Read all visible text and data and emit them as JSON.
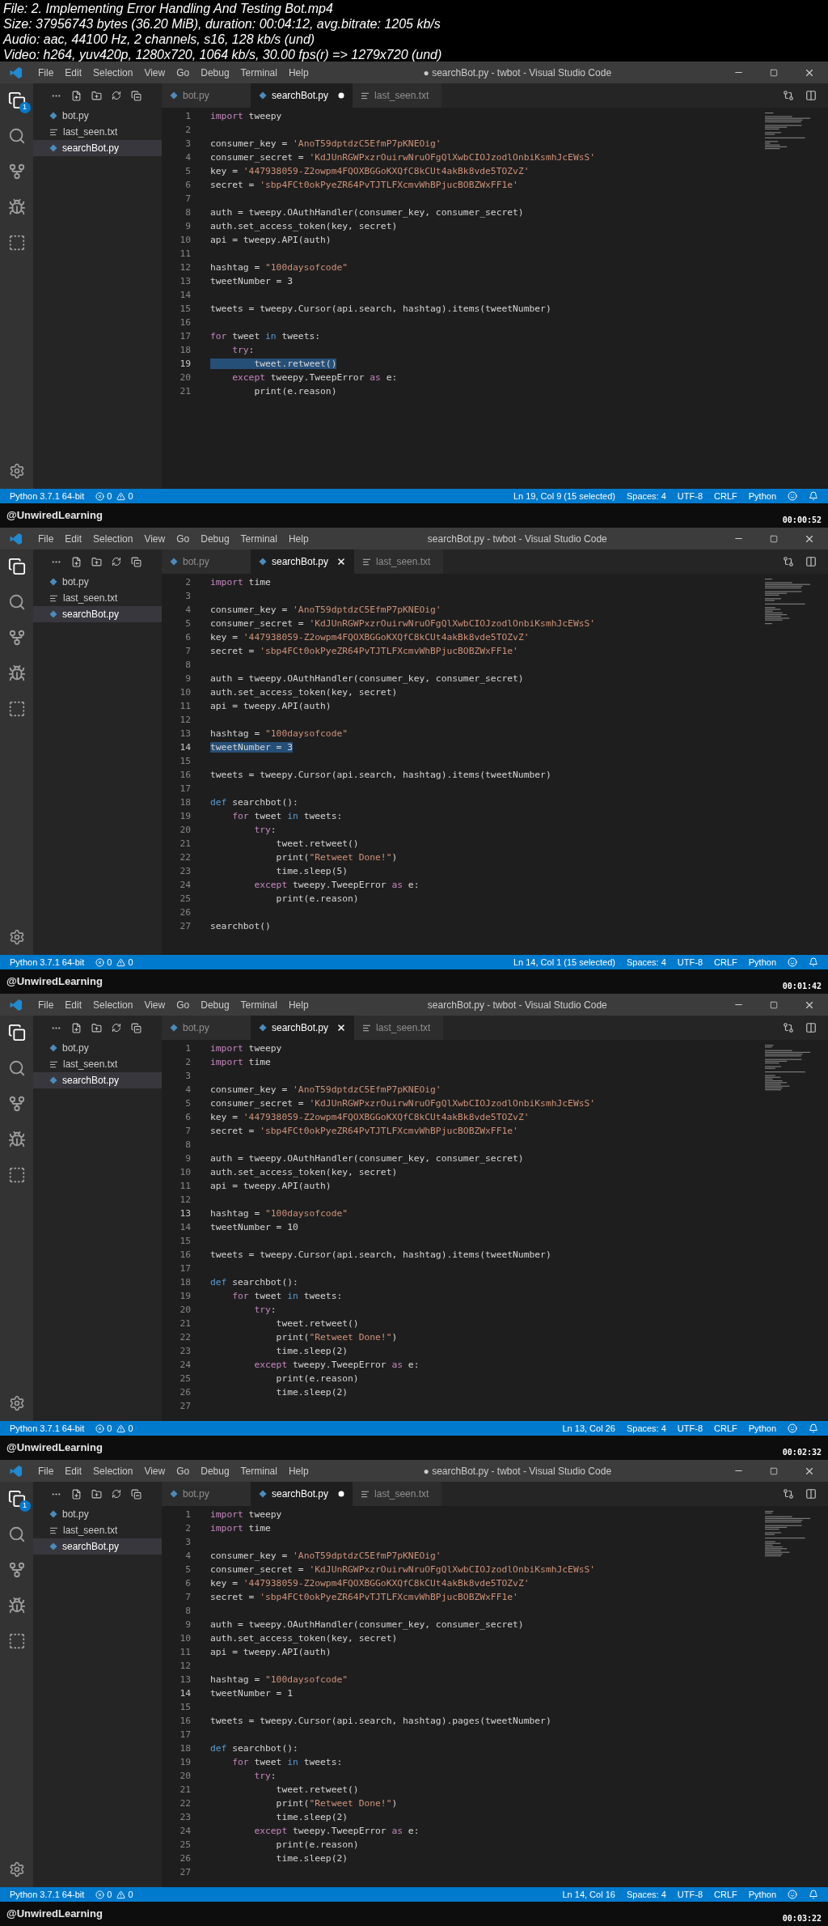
{
  "file_info": [
    "File: 2. Implementing Error Handling And Testing Bot.mp4",
    "Size: 37956743 bytes (36.20 MiB), duration: 00:04:12, avg.bitrate: 1205 kb/s",
    "Audio: aac, 44100 Hz, 2 channels, s16, 128 kb/s (und)",
    "Video: h264, yuv420p, 1280x720, 1064 kb/s, 30.00 fps(r) => 1279x720 (und)"
  ],
  "frames": [
    {
      "title": "● searchBot.py - twbot - Visual Studio Code",
      "menu": [
        "File",
        "Edit",
        "Selection",
        "View",
        "Go",
        "Debug",
        "Terminal",
        "Help"
      ],
      "explorer_badge": "1",
      "files": [
        {
          "name": "bot.py",
          "kind": "py",
          "selected": false
        },
        {
          "name": "last_seen.txt",
          "kind": "txt",
          "selected": false
        },
        {
          "name": "searchBot.py",
          "kind": "py",
          "selected": true
        }
      ],
      "tabs": [
        {
          "label": "bot.py",
          "kind": "py",
          "selected": false
        },
        {
          "label": "searchBot.py",
          "kind": "py",
          "selected": true,
          "dirty": true
        },
        {
          "label": "last_seen.txt",
          "kind": "txt",
          "selected": false
        }
      ],
      "lines": [
        {
          "n": "1",
          "current": false,
          "tokens": [
            {
              "text": "import",
              "kind": "kw"
            },
            {
              "text": " tweepy",
              "kind": "plain"
            }
          ]
        },
        {
          "n": "2",
          "current": false
        },
        {
          "n": "3",
          "current": false,
          "tokens": [
            {
              "text": "consumer_key = ",
              "kind": "plain"
            },
            {
              "text": "'AnoT59dptdzC5EfmP7pKNEOig'",
              "kind": "str"
            }
          ]
        },
        {
          "n": "4",
          "current": false,
          "tokens": [
            {
              "text": "consumer_secret = ",
              "kind": "plain"
            },
            {
              "text": "'KdJUnRGWPxzrOuirwNruOFgQlXwbCIOJzodlOnbiKsmhJcEWsS'",
              "kind": "str"
            }
          ]
        },
        {
          "n": "5",
          "current": false,
          "tokens": [
            {
              "text": "key = ",
              "kind": "plain"
            },
            {
              "text": "'447938059-Z2owpm4FQOXBGGoKXQfC8kCUt4akBk8vde5TOZvZ'",
              "kind": "str"
            }
          ]
        },
        {
          "n": "6",
          "current": false,
          "tokens": [
            {
              "text": "secret = ",
              "kind": "plain"
            },
            {
              "text": "'sbp4FCt0okPyeZR64PvTJTLFXcmvWhBPjucBOBZWxFF1e'",
              "kind": "str"
            }
          ]
        },
        {
          "n": "7",
          "current": false
        },
        {
          "n": "8",
          "current": false,
          "tokens": [
            {
              "text": "auth = tweepy.OAuthHandler(consumer_key, consumer_secret)",
              "kind": "plain"
            }
          ]
        },
        {
          "n": "9",
          "current": false,
          "tokens": [
            {
              "text": "auth.set_access_token(key, secret)",
              "kind": "plain"
            }
          ]
        },
        {
          "n": "10",
          "current": false,
          "tokens": [
            {
              "text": "api = tweepy.API(auth)",
              "kind": "plain"
            }
          ]
        },
        {
          "n": "11",
          "current": false
        },
        {
          "n": "12",
          "current": false,
          "tokens": [
            {
              "text": "hashtag = ",
              "kind": "plain"
            },
            {
              "text": "\"100daysofcode\"",
              "kind": "str"
            }
          ]
        },
        {
          "n": "13",
          "current": false,
          "tokens": [
            {
              "text": "tweetNumber = 3",
              "kind": "plain"
            }
          ]
        },
        {
          "n": "14",
          "current": false
        },
        {
          "n": "15",
          "current": false,
          "tokens": [
            {
              "text": "tweets = tweepy.Cursor(api.search, hashtag).items(tweetNumber)",
              "kind": "plain"
            }
          ]
        },
        {
          "n": "16",
          "current": false
        },
        {
          "n": "17",
          "current": false,
          "tokens": [
            {
              "text": "for",
              "kind": "kw"
            },
            {
              "text": " tweet ",
              "kind": "plain"
            },
            {
              "text": "in",
              "kind": "blue"
            },
            {
              "text": " tweets:",
              "kind": "plain"
            }
          ]
        },
        {
          "n": "18",
          "current": false,
          "tokens": [
            {
              "text": "    try",
              "kind": "kw"
            },
            {
              "text": ":",
              "kind": "plain"
            }
          ]
        },
        {
          "n": "19",
          "current": true,
          "tokens": [
            {
              "text": "        tweet.retweet()",
              "kind": "sel"
            }
          ]
        },
        {
          "n": "20",
          "current": false,
          "tokens": [
            {
              "text": "    except",
              "kind": "kw"
            },
            {
              "text": " tweepy.TweepError ",
              "kind": "plain"
            },
            {
              "text": "as",
              "kind": "kw"
            },
            {
              "text": " e:",
              "kind": "plain"
            }
          ]
        },
        {
          "n": "21",
          "current": false,
          "tokens": [
            {
              "text": "        print(e.reason)",
              "kind": "plain"
            }
          ]
        }
      ],
      "status_left": {
        "interpreter": "Python 3.7.1 64-bit",
        "errors": "0",
        "warnings": "0"
      },
      "status_right": [
        "Ln 19, Col 9 (15 selected)",
        "Spaces: 4",
        "UTF-8",
        "CRLF",
        "Python"
      ],
      "channel": "@UnwiredLearning",
      "timestamp": "00:00:52"
    },
    {
      "title": "searchBot.py - twbot - Visual Studio Code",
      "menu": [
        "File",
        "Edit",
        "Selection",
        "View",
        "Go",
        "Debug",
        "Terminal",
        "Help"
      ],
      "files": [
        {
          "name": "bot.py",
          "kind": "py",
          "selected": false
        },
        {
          "name": "last_seen.txt",
          "kind": "txt",
          "selected": false
        },
        {
          "name": "searchBot.py",
          "kind": "py",
          "selected": true
        }
      ],
      "tabs": [
        {
          "label": "bot.py",
          "kind": "py",
          "selected": false
        },
        {
          "label": "searchBot.py",
          "kind": "py",
          "selected": true,
          "dirty": false
        },
        {
          "label": "last_seen.txt",
          "kind": "txt",
          "selected": false
        }
      ],
      "lines": [
        {
          "n": "2",
          "current": false,
          "tokens": [
            {
              "text": "import",
              "kind": "kw"
            },
            {
              "text": " time",
              "kind": "plain"
            }
          ]
        },
        {
          "n": "3",
          "current": false
        },
        {
          "n": "4",
          "current": false,
          "tokens": [
            {
              "text": "consumer_key = ",
              "kind": "plain"
            },
            {
              "text": "'AnoT59dptdzC5EfmP7pKNEOig'",
              "kind": "str"
            }
          ]
        },
        {
          "n": "5",
          "current": false,
          "tokens": [
            {
              "text": "consumer_secret = ",
              "kind": "plain"
            },
            {
              "text": "'KdJUnRGWPxzrOuirwNruOFgQlXwbCIOJzodlOnbiKsmhJcEWsS'",
              "kind": "str"
            }
          ]
        },
        {
          "n": "6",
          "current": false,
          "tokens": [
            {
              "text": "key = ",
              "kind": "plain"
            },
            {
              "text": "'447938059-Z2owpm4FQOXBGGoKXQfC8kCUt4akBk8vde5TOZvZ'",
              "kind": "str"
            }
          ]
        },
        {
          "n": "7",
          "current": false,
          "tokens": [
            {
              "text": "secret = ",
              "kind": "plain"
            },
            {
              "text": "'sbp4FCt0okPyeZR64PvTJTLFXcmvWhBPjucBOBZWxFF1e'",
              "kind": "str"
            }
          ]
        },
        {
          "n": "8",
          "current": false
        },
        {
          "n": "9",
          "current": false,
          "tokens": [
            {
              "text": "auth = tweepy.OAuthHandler(consumer_key, consumer_secret)",
              "kind": "plain"
            }
          ]
        },
        {
          "n": "10",
          "current": false,
          "tokens": [
            {
              "text": "auth.set_access_token(key, secret)",
              "kind": "plain"
            }
          ]
        },
        {
          "n": "11",
          "current": false,
          "tokens": [
            {
              "text": "api = tweepy.API(auth)",
              "kind": "plain"
            }
          ]
        },
        {
          "n": "12",
          "current": false
        },
        {
          "n": "13",
          "current": false,
          "tokens": [
            {
              "text": "hashtag = ",
              "kind": "plain"
            },
            {
              "text": "\"100daysofcode\"",
              "kind": "str"
            }
          ]
        },
        {
          "n": "14",
          "current": true,
          "tokens": [
            {
              "text": "tweetNumber = 3",
              "kind": "sel"
            }
          ]
        },
        {
          "n": "15",
          "current": false
        },
        {
          "n": "16",
          "current": false,
          "tokens": [
            {
              "text": "tweets = tweepy.Cursor(api.search, hashtag).items(tweetNumber)",
              "kind": "plain"
            }
          ]
        },
        {
          "n": "17",
          "current": false
        },
        {
          "n": "18",
          "current": false,
          "tokens": [
            {
              "text": "def",
              "kind": "blue"
            },
            {
              "text": " searchbot():",
              "kind": "plain"
            }
          ]
        },
        {
          "n": "19",
          "current": false,
          "tokens": [
            {
              "text": "    for",
              "kind": "kw"
            },
            {
              "text": " tweet ",
              "kind": "plain"
            },
            {
              "text": "in",
              "kind": "blue"
            },
            {
              "text": " tweets:",
              "kind": "plain"
            }
          ]
        },
        {
          "n": "20",
          "current": false,
          "tokens": [
            {
              "text": "        try",
              "kind": "kw"
            },
            {
              "text": ":",
              "kind": "plain"
            }
          ]
        },
        {
          "n": "21",
          "current": false,
          "tokens": [
            {
              "text": "            tweet.retweet()",
              "kind": "plain"
            }
          ]
        },
        {
          "n": "22",
          "current": false,
          "tokens": [
            {
              "text": "            print(",
              "kind": "plain"
            },
            {
              "text": "\"Retweet Done!\"",
              "kind": "str"
            },
            {
              "text": ")",
              "kind": "plain"
            }
          ]
        },
        {
          "n": "23",
          "current": false,
          "tokens": [
            {
              "text": "            time.sleep(5)",
              "kind": "plain"
            }
          ]
        },
        {
          "n": "24",
          "current": false,
          "tokens": [
            {
              "text": "        except",
              "kind": "kw"
            },
            {
              "text": " tweepy.TweepError ",
              "kind": "plain"
            },
            {
              "text": "as",
              "kind": "kw"
            },
            {
              "text": " e:",
              "kind": "plain"
            }
          ]
        },
        {
          "n": "25",
          "current": false,
          "tokens": [
            {
              "text": "            print(e.reason)",
              "kind": "plain"
            }
          ]
        },
        {
          "n": "26",
          "current": false
        },
        {
          "n": "27",
          "current": false,
          "tokens": [
            {
              "text": "searchbot()",
              "kind": "plain"
            }
          ]
        }
      ],
      "status_left": {
        "interpreter": "Python 3.7.1 64-bit",
        "errors": "0",
        "warnings": "0"
      },
      "status_right": [
        "Ln 14, Col 1 (15 selected)",
        "Spaces: 4",
        "UTF-8",
        "CRLF",
        "Python"
      ],
      "channel": "@UnwiredLearning",
      "timestamp": "00:01:42"
    },
    {
      "title": "searchBot.py - twbot - Visual Studio Code",
      "menu": [
        "File",
        "Edit",
        "Selection",
        "View",
        "Go",
        "Debug",
        "Terminal",
        "Help"
      ],
      "files": [
        {
          "name": "bot.py",
          "kind": "py",
          "selected": false
        },
        {
          "name": "last_seen.txt",
          "kind": "txt",
          "selected": false
        },
        {
          "name": "searchBot.py",
          "kind": "py",
          "selected": true
        }
      ],
      "tabs": [
        {
          "label": "bot.py",
          "kind": "py",
          "selected": false
        },
        {
          "label": "searchBot.py",
          "kind": "py",
          "selected": true,
          "dirty": false
        },
        {
          "label": "last_seen.txt",
          "kind": "txt",
          "selected": false
        }
      ],
      "lines": [
        {
          "n": "1",
          "current": false,
          "tokens": [
            {
              "text": "import",
              "kind": "kw"
            },
            {
              "text": " tweepy",
              "kind": "plain"
            }
          ]
        },
        {
          "n": "2",
          "current": false,
          "tokens": [
            {
              "text": "import",
              "kind": "kw"
            },
            {
              "text": " time",
              "kind": "plain"
            }
          ]
        },
        {
          "n": "3",
          "current": false
        },
        {
          "n": "4",
          "current": false,
          "tokens": [
            {
              "text": "consumer_key = ",
              "kind": "plain"
            },
            {
              "text": "'AnoT59dptdzC5EfmP7pKNEOig'",
              "kind": "str"
            }
          ]
        },
        {
          "n": "5",
          "current": false,
          "tokens": [
            {
              "text": "consumer_secret = ",
              "kind": "plain"
            },
            {
              "text": "'KdJUnRGWPxzrOuirwNruOFgQlXwbCIOJzodlOnbiKsmhJcEWsS'",
              "kind": "str"
            }
          ]
        },
        {
          "n": "6",
          "current": false,
          "tokens": [
            {
              "text": "key = ",
              "kind": "plain"
            },
            {
              "text": "'447938059-Z2owpm4FQOXBGGoKXQfC8kCUt4akBk8vde5TOZvZ'",
              "kind": "str"
            }
          ]
        },
        {
          "n": "7",
          "current": false,
          "tokens": [
            {
              "text": "secret = ",
              "kind": "plain"
            },
            {
              "text": "'sbp4FCt0okPyeZR64PvTJTLFXcmvWhBPjucBOBZWxFF1e'",
              "kind": "str"
            }
          ]
        },
        {
          "n": "8",
          "current": false
        },
        {
          "n": "9",
          "current": false,
          "tokens": [
            {
              "text": "auth = tweepy.OAuthHandler(consumer_key, consumer_secret)",
              "kind": "plain"
            }
          ]
        },
        {
          "n": "10",
          "current": false,
          "tokens": [
            {
              "text": "auth.set_access_token(key, secret)",
              "kind": "plain"
            }
          ]
        },
        {
          "n": "11",
          "current": false,
          "tokens": [
            {
              "text": "api = tweepy.API(auth)",
              "kind": "plain"
            }
          ]
        },
        {
          "n": "12",
          "current": false
        },
        {
          "n": "13",
          "current": true,
          "tokens": [
            {
              "text": "hashtag = ",
              "kind": "plain"
            },
            {
              "text": "\"100daysofcode\"",
              "kind": "str"
            }
          ]
        },
        {
          "n": "14",
          "current": false,
          "tokens": [
            {
              "text": "tweetNumber = 10",
              "kind": "plain"
            }
          ]
        },
        {
          "n": "15",
          "current": false
        },
        {
          "n": "16",
          "current": false,
          "tokens": [
            {
              "text": "tweets = tweepy.Cursor(api.search, hashtag).items(tweetNumber)",
              "kind": "plain"
            }
          ]
        },
        {
          "n": "17",
          "current": false
        },
        {
          "n": "18",
          "current": false,
          "tokens": [
            {
              "text": "def",
              "kind": "blue"
            },
            {
              "text": " searchbot():",
              "kind": "plain"
            }
          ]
        },
        {
          "n": "19",
          "current": false,
          "tokens": [
            {
              "text": "    for",
              "kind": "kw"
            },
            {
              "text": " tweet ",
              "kind": "plain"
            },
            {
              "text": "in",
              "kind": "blue"
            },
            {
              "text": " tweets:",
              "kind": "plain"
            }
          ]
        },
        {
          "n": "20",
          "current": false,
          "tokens": [
            {
              "text": "        try",
              "kind": "kw"
            },
            {
              "text": ":",
              "kind": "plain"
            }
          ]
        },
        {
          "n": "21",
          "current": false,
          "tokens": [
            {
              "text": "            tweet.retweet()",
              "kind": "plain"
            }
          ]
        },
        {
          "n": "22",
          "current": false,
          "tokens": [
            {
              "text": "            print(",
              "kind": "plain"
            },
            {
              "text": "\"Retweet Done!\"",
              "kind": "str"
            },
            {
              "text": ")",
              "kind": "plain"
            }
          ]
        },
        {
          "n": "23",
          "current": false,
          "tokens": [
            {
              "text": "            time.sleep(2)",
              "kind": "plain"
            }
          ]
        },
        {
          "n": "24",
          "current": false,
          "tokens": [
            {
              "text": "        except",
              "kind": "kw"
            },
            {
              "text": " tweepy.TweepError ",
              "kind": "plain"
            },
            {
              "text": "as",
              "kind": "kw"
            },
            {
              "text": " e:",
              "kind": "plain"
            }
          ]
        },
        {
          "n": "25",
          "current": false,
          "tokens": [
            {
              "text": "            print(e.reason)",
              "kind": "plain"
            }
          ]
        },
        {
          "n": "26",
          "current": false,
          "tokens": [
            {
              "text": "            time.sleep(2)",
              "kind": "plain"
            }
          ]
        },
        {
          "n": "27",
          "current": false
        }
      ],
      "status_left": {
        "interpreter": "Python 3.7.1 64-bit",
        "errors": "0",
        "warnings": "0"
      },
      "status_right": [
        "Ln 13, Col 26",
        "Spaces: 4",
        "UTF-8",
        "CRLF",
        "Python"
      ],
      "channel": "@UnwiredLearning",
      "timestamp": "00:02:32"
    },
    {
      "title": "● searchBot.py - twbot - Visual Studio Code",
      "menu": [
        "File",
        "Edit",
        "Selection",
        "View",
        "Go",
        "Debug",
        "Terminal",
        "Help"
      ],
      "explorer_badge": "1",
      "files": [
        {
          "name": "bot.py",
          "kind": "py",
          "selected": false
        },
        {
          "name": "last_seen.txt",
          "kind": "txt",
          "selected": false
        },
        {
          "name": "searchBot.py",
          "kind": "py",
          "selected": true
        }
      ],
      "tabs": [
        {
          "label": "bot.py",
          "kind": "py",
          "selected": false
        },
        {
          "label": "searchBot.py",
          "kind": "py",
          "selected": true,
          "dirty": true
        },
        {
          "label": "last_seen.txt",
          "kind": "txt",
          "selected": false
        }
      ],
      "lines": [
        {
          "n": "1",
          "current": false,
          "tokens": [
            {
              "text": "import",
              "kind": "kw"
            },
            {
              "text": " tweepy",
              "kind": "plain"
            }
          ]
        },
        {
          "n": "2",
          "current": false,
          "tokens": [
            {
              "text": "import",
              "kind": "kw"
            },
            {
              "text": " time",
              "kind": "plain"
            }
          ]
        },
        {
          "n": "3",
          "current": false
        },
        {
          "n": "4",
          "current": false,
          "tokens": [
            {
              "text": "consumer_key = ",
              "kind": "plain"
            },
            {
              "text": "'AnoT59dptdzC5EfmP7pKNEOig'",
              "kind": "str"
            }
          ]
        },
        {
          "n": "5",
          "current": false,
          "tokens": [
            {
              "text": "consumer_secret = ",
              "kind": "plain"
            },
            {
              "text": "'KdJUnRGWPxzrOuirwNruOFgQlXwbCIOJzodlOnbiKsmhJcEWsS'",
              "kind": "str"
            }
          ]
        },
        {
          "n": "6",
          "current": false,
          "tokens": [
            {
              "text": "key = ",
              "kind": "plain"
            },
            {
              "text": "'447938059-Z2owpm4FQOXBGGoKXQfC8kCUt4akBk8vde5TOZvZ'",
              "kind": "str"
            }
          ]
        },
        {
          "n": "7",
          "current": false,
          "tokens": [
            {
              "text": "secret = ",
              "kind": "plain"
            },
            {
              "text": "'sbp4FCt0okPyeZR64PvTJTLFXcmvWhBPjucBOBZWxFF1e'",
              "kind": "str"
            }
          ]
        },
        {
          "n": "8",
          "current": false
        },
        {
          "n": "9",
          "current": false,
          "tokens": [
            {
              "text": "auth = tweepy.OAuthHandler(consumer_key, consumer_secret)",
              "kind": "plain"
            }
          ]
        },
        {
          "n": "10",
          "current": false,
          "tokens": [
            {
              "text": "auth.set_access_token(key, secret)",
              "kind": "plain"
            }
          ]
        },
        {
          "n": "11",
          "current": false,
          "tokens": [
            {
              "text": "api = tweepy.API(auth)",
              "kind": "plain"
            }
          ]
        },
        {
          "n": "12",
          "current": false
        },
        {
          "n": "13",
          "current": false,
          "tokens": [
            {
              "text": "hashtag = ",
              "kind": "plain"
            },
            {
              "text": "\"100daysofcode\"",
              "kind": "str"
            }
          ]
        },
        {
          "n": "14",
          "current": true,
          "tokens": [
            {
              "text": "tweetNumber = 1",
              "kind": "plain"
            }
          ]
        },
        {
          "n": "15",
          "current": false
        },
        {
          "n": "16",
          "current": false,
          "tokens": [
            {
              "text": "tweets = tweepy.Cursor(api.search, hashtag).pages(tweetNumber)",
              "kind": "plain"
            }
          ]
        },
        {
          "n": "17",
          "current": false
        },
        {
          "n": "18",
          "current": false,
          "tokens": [
            {
              "text": "def",
              "kind": "blue"
            },
            {
              "text": " searchbot():",
              "kind": "plain"
            }
          ]
        },
        {
          "n": "19",
          "current": false,
          "tokens": [
            {
              "text": "    for",
              "kind": "kw"
            },
            {
              "text": " tweet ",
              "kind": "plain"
            },
            {
              "text": "in",
              "kind": "blue"
            },
            {
              "text": " tweets:",
              "kind": "plain"
            }
          ]
        },
        {
          "n": "20",
          "current": false,
          "tokens": [
            {
              "text": "        try",
              "kind": "kw"
            },
            {
              "text": ":",
              "kind": "plain"
            }
          ]
        },
        {
          "n": "21",
          "current": false,
          "tokens": [
            {
              "text": "            tweet.retweet()",
              "kind": "plain"
            }
          ]
        },
        {
          "n": "22",
          "current": false,
          "tokens": [
            {
              "text": "            print(",
              "kind": "plain"
            },
            {
              "text": "\"Retweet Done!\"",
              "kind": "str"
            },
            {
              "text": ")",
              "kind": "plain"
            }
          ]
        },
        {
          "n": "23",
          "current": false,
          "tokens": [
            {
              "text": "            time.sleep(2)",
              "kind": "plain"
            }
          ]
        },
        {
          "n": "24",
          "current": false,
          "tokens": [
            {
              "text": "        except",
              "kind": "kw"
            },
            {
              "text": " tweepy.TweepError ",
              "kind": "plain"
            },
            {
              "text": "as",
              "kind": "kw"
            },
            {
              "text": " e:",
              "kind": "plain"
            }
          ]
        },
        {
          "n": "25",
          "current": false,
          "tokens": [
            {
              "text": "            print(e.reason)",
              "kind": "plain"
            }
          ]
        },
        {
          "n": "26",
          "current": false,
          "tokens": [
            {
              "text": "            time.sleep(2)",
              "kind": "plain"
            }
          ]
        },
        {
          "n": "27",
          "current": false
        }
      ],
      "status_left": {
        "interpreter": "Python 3.7.1 64-bit",
        "errors": "0",
        "warnings": "0"
      },
      "status_right": [
        "Ln 14, Col 16",
        "Spaces: 4",
        "UTF-8",
        "CRLF",
        "Python"
      ],
      "channel": "@UnwiredLearning",
      "timestamp": "00:03:22"
    }
  ]
}
